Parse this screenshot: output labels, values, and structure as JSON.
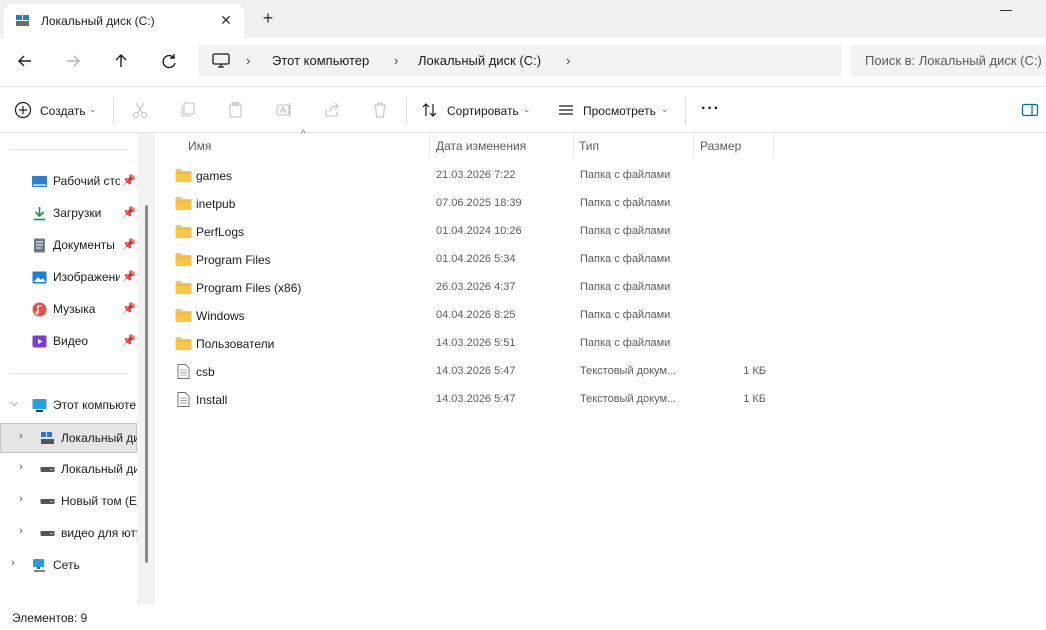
{
  "tab": {
    "title": "Локальный диск (C:)",
    "close_glyph": "✕",
    "new_glyph": "+"
  },
  "breadcrumb": {
    "items": [
      "Этот компьютер",
      "Локальный диск (C:)"
    ],
    "sep": "›"
  },
  "search": {
    "placeholder": "Поиск в: Локальный диск (C:)"
  },
  "commands": {
    "create": "Создать",
    "sort": "Сортировать",
    "view": "Просмотреть",
    "more": "···",
    "chevron": "⌄"
  },
  "sidebar": {
    "quick": [
      {
        "label": "Рабочий сто",
        "icon": "desktop-icon",
        "color": "#2f7fd1"
      },
      {
        "label": "Загрузки",
        "icon": "download-icon",
        "color": "#1a8f4a"
      },
      {
        "label": "Документы",
        "icon": "document-icon",
        "color": "#5b6b7b"
      },
      {
        "label": "Изображени",
        "icon": "pictures-icon",
        "color": "#1b7fd6"
      },
      {
        "label": "Музыка",
        "icon": "music-icon",
        "color": "#e0524b"
      },
      {
        "label": "Видео",
        "icon": "video-icon",
        "color": "#7a3fd1"
      }
    ],
    "pin_glyph": "📌",
    "this_pc": "Этот компьюте",
    "drives": [
      {
        "label": "Локальный ди",
        "icon": "windows-drive-icon"
      },
      {
        "label": "Локальный ди",
        "icon": "drive-icon"
      },
      {
        "label": "Новый том (E",
        "icon": "drive-icon"
      },
      {
        "label": "видео для юту",
        "icon": "drive-icon"
      }
    ],
    "network": "Сеть"
  },
  "columns": {
    "name": "Имя",
    "date": "Дата изменения",
    "type": "Тип",
    "size": "Размер",
    "sort_arrow": "^"
  },
  "files": [
    {
      "name": "games",
      "date": "21.03.2026 7:22",
      "type": "Папка с файлами",
      "size": "",
      "kind": "folder"
    },
    {
      "name": "inetpub",
      "date": "07.06.2025 18:39",
      "type": "Папка с файлами",
      "size": "",
      "kind": "folder"
    },
    {
      "name": "PerfLogs",
      "date": "01.04.2024 10:26",
      "type": "Папка с файлами",
      "size": "",
      "kind": "folder"
    },
    {
      "name": "Program Files",
      "date": "01.04.2026 5:34",
      "type": "Папка с файлами",
      "size": "",
      "kind": "folder"
    },
    {
      "name": "Program Files (x86)",
      "date": "26.03.2026 4:37",
      "type": "Папка с файлами",
      "size": "",
      "kind": "folder"
    },
    {
      "name": "Windows",
      "date": "04.04.2026 8:25",
      "type": "Папка с файлами",
      "size": "",
      "kind": "folder"
    },
    {
      "name": "Пользователи",
      "date": "14.03.2026 5:51",
      "type": "Папка с файлами",
      "size": "",
      "kind": "folder"
    },
    {
      "name": "csb",
      "date": "14.03.2026 5:47",
      "type": "Текстовый докум...",
      "size": "1 КБ",
      "kind": "file"
    },
    {
      "name": "Install",
      "date": "14.03.2026 5:47",
      "type": "Текстовый докум...",
      "size": "1 КБ",
      "kind": "file"
    }
  ],
  "status": {
    "items_count": "Элементов: 9"
  },
  "colors": {
    "folder": "#f8c74a",
    "accent": "#0067c0"
  }
}
